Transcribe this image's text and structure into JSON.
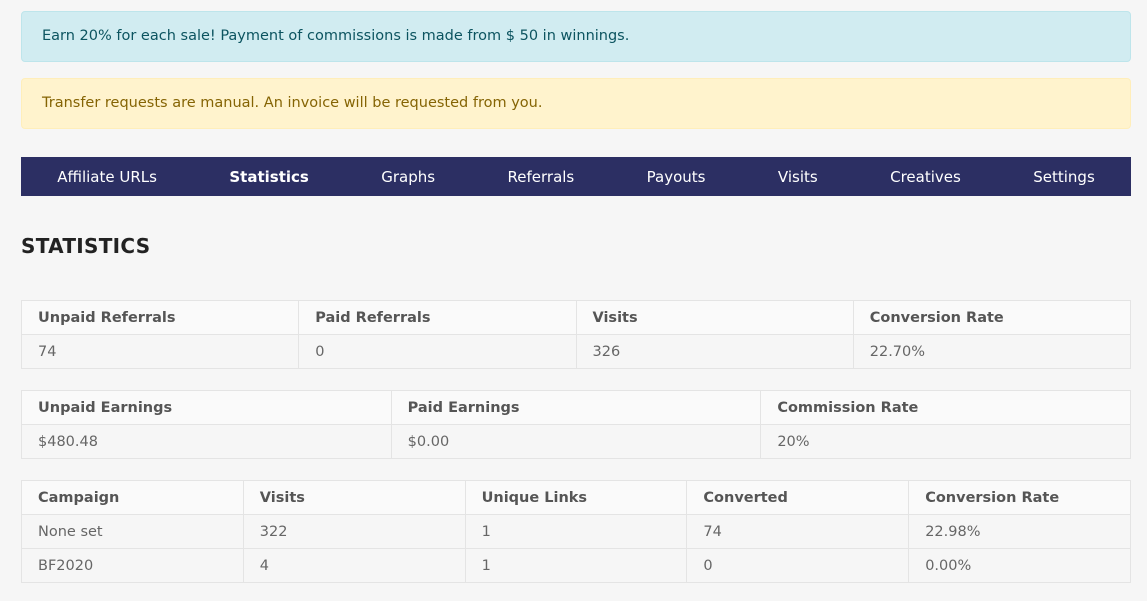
{
  "alerts": {
    "info": "Earn 20% for each sale! Payment of commissions is made from $ 50 in winnings.",
    "warning": "Transfer requests are manual. An invoice will be requested from you."
  },
  "tabs": [
    {
      "label": "Affiliate URLs"
    },
    {
      "label": "Statistics"
    },
    {
      "label": "Graphs"
    },
    {
      "label": "Referrals"
    },
    {
      "label": "Payouts"
    },
    {
      "label": "Visits"
    },
    {
      "label": "Creatives"
    },
    {
      "label": "Settings"
    }
  ],
  "active_tab": "Statistics",
  "page_title": "STATISTICS",
  "referrals_table": {
    "headers": [
      "Unpaid Referrals",
      "Paid Referrals",
      "Visits",
      "Conversion Rate"
    ],
    "values": [
      "74",
      "0",
      "326",
      "22.70%"
    ]
  },
  "earnings_table": {
    "headers": [
      "Unpaid Earnings",
      "Paid Earnings",
      "Commission Rate"
    ],
    "values": [
      "$480.48",
      "$0.00",
      "20%"
    ]
  },
  "campaign_table": {
    "headers": [
      "Campaign",
      "Visits",
      "Unique Links",
      "Converted",
      "Conversion Rate"
    ],
    "rows": [
      [
        "None set",
        "322",
        "1",
        "74",
        "22.98%"
      ],
      [
        "BF2020",
        "4",
        "1",
        "0",
        "0.00%"
      ]
    ]
  },
  "colors": {
    "nav_background": "#2c2f63",
    "info_background": "#d1ecf1",
    "warning_background": "#fff3cd"
  }
}
